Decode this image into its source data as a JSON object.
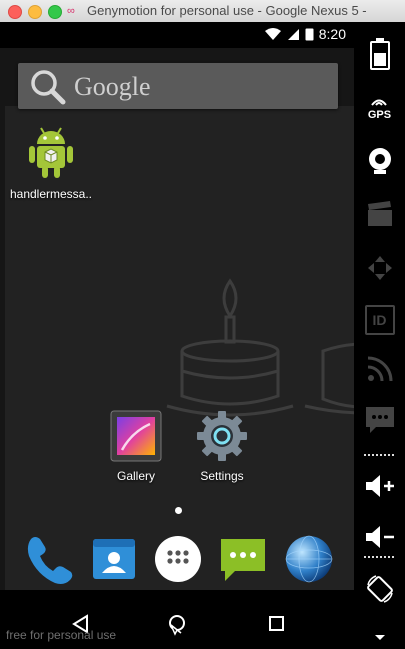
{
  "window": {
    "title": "Genymotion for personal use - Google Nexus 5 -",
    "app_icon": "genymotion-logo-icon"
  },
  "statusbar": {
    "time": "8:20",
    "icons": [
      "wifi-icon",
      "signal-icon",
      "sim-icon"
    ]
  },
  "search": {
    "text": "Google",
    "icon": "search-icon"
  },
  "apps": [
    {
      "label": "handlermessa..",
      "icon": "android-robot-icon"
    },
    {
      "label": "Gallery",
      "icon": "gallery-icon"
    },
    {
      "label": "Settings",
      "icon": "settings-gear-icon"
    }
  ],
  "dock": [
    {
      "name": "phone-icon"
    },
    {
      "name": "contacts-icon"
    },
    {
      "name": "app-drawer-icon"
    },
    {
      "name": "messaging-icon"
    },
    {
      "name": "browser-globe-icon"
    }
  ],
  "navbar": {
    "back": "back-icon",
    "home": "home-icon",
    "recents": "recents-icon"
  },
  "watermark": "free for personal use",
  "toolbar": {
    "items": [
      "battery-icon",
      "gps-icon",
      "camera-icon",
      "clapperboard-icon",
      "dpad-icon",
      "id-icon",
      "rss-icon",
      "sms-icon",
      "volume-up-icon",
      "volume-down-icon",
      "rotate-icon",
      "more-icon"
    ],
    "gps_label": "GPS",
    "id_label": "ID"
  },
  "colors": {
    "android_green": "#a4c639",
    "dock_blue": "#2f8fd8",
    "sms_green": "#8cbf26"
  }
}
